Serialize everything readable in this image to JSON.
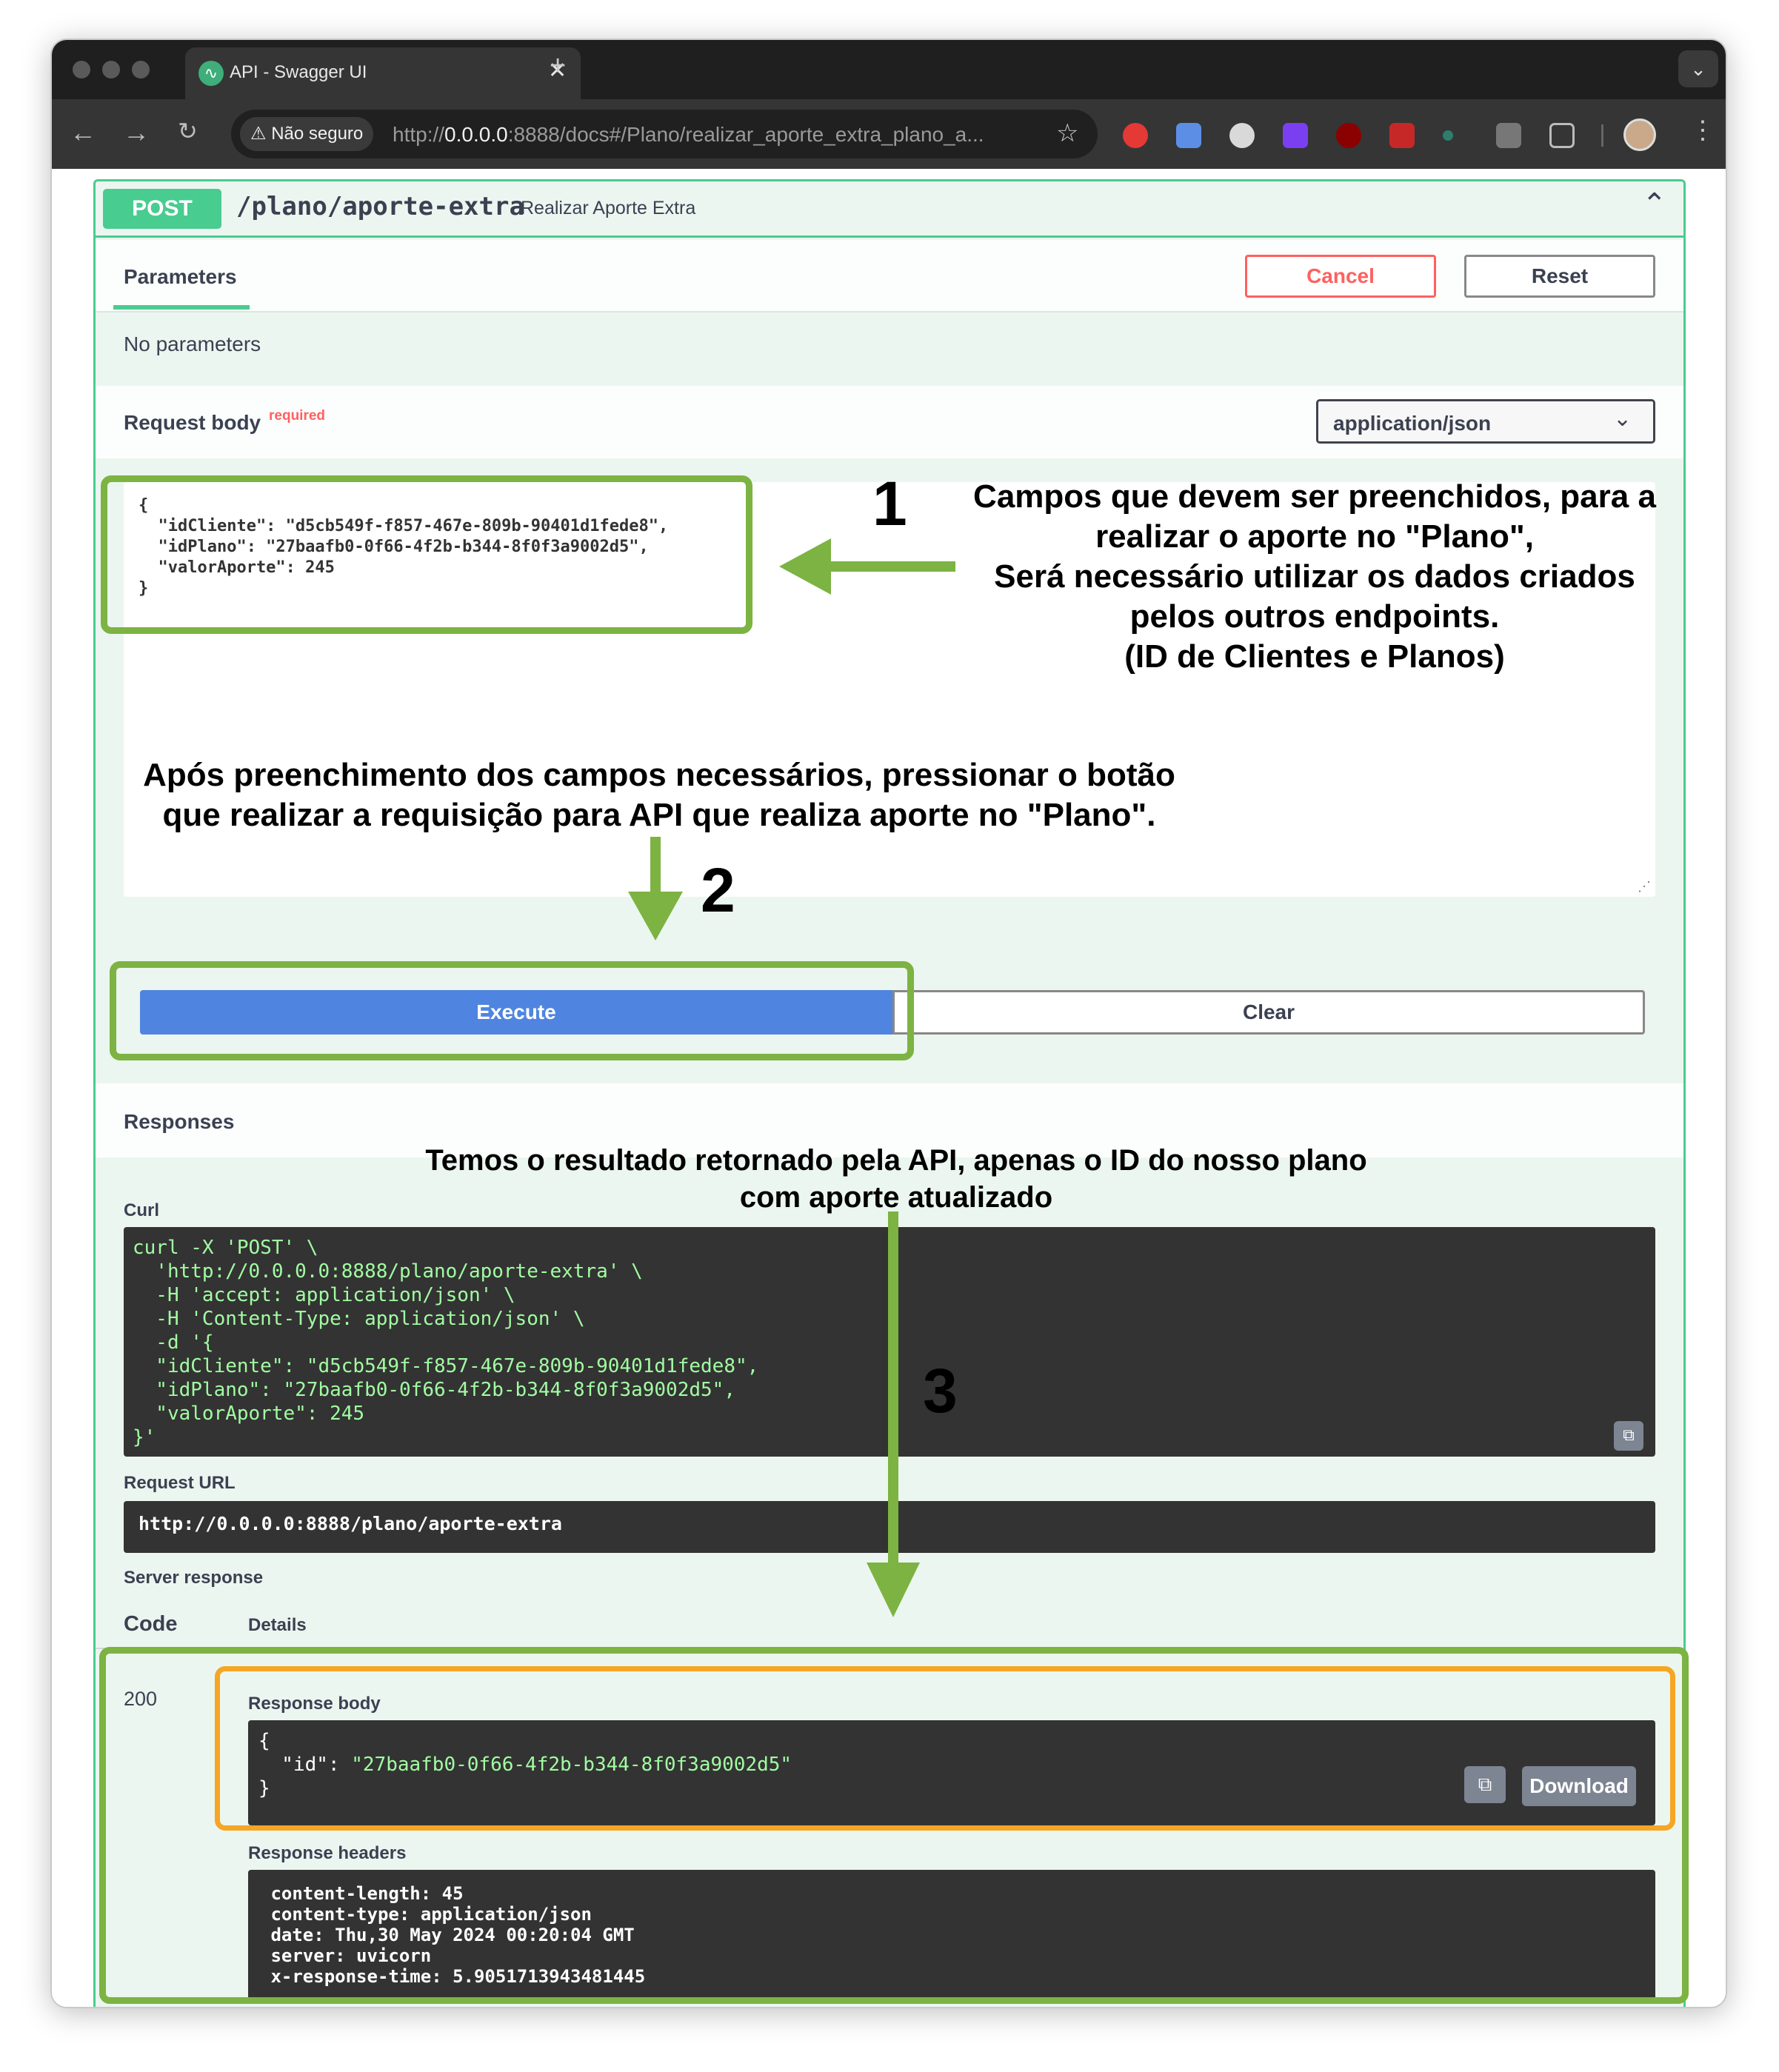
{
  "browser": {
    "tab_title": "API - Swagger UI",
    "tab_close": "✕",
    "new_tab": "+",
    "security_label": "Não seguro",
    "url_prefix": "http://",
    "url_host": "0.0.0.0",
    "url_rest": ":8888/docs#/Plano/realizar_aporte_extra_plano_a..."
  },
  "operation": {
    "method": "POST",
    "path": "/plano/aporte-extra",
    "summary": "Realizar Aporte Extra",
    "tab_parameters": "Parameters",
    "cancel_label": "Cancel",
    "reset_label": "Reset",
    "no_parameters": "No parameters",
    "request_body_label": "Request body",
    "required_label": "required",
    "content_type": "application/json",
    "request_body_json": "{\n  \"idCliente\": \"d5cb549f-f857-467e-809b-90401d1fede8\",\n  \"idPlano\": \"27baafb0-0f66-4f2b-b344-8f0f3a9002d5\",\n  \"valorAporte\": 245\n}",
    "execute_label": "Execute",
    "clear_label": "Clear"
  },
  "responses": {
    "title": "Responses",
    "curl_label": "Curl",
    "curl_code": "curl -X 'POST' \\\n  'http://0.0.0.0:8888/plano/aporte-extra' \\\n  -H 'accept: application/json' \\\n  -H 'Content-Type: application/json' \\\n  -d '{\n  \"idCliente\": \"d5cb549f-f857-467e-809b-90401d1fede8\",\n  \"idPlano\": \"27baafb0-0f66-4f2b-b344-8f0f3a9002d5\",\n  \"valorAporte\": 245\n}'",
    "request_url_label": "Request URL",
    "request_url": "http://0.0.0.0:8888/plano/aporte-extra",
    "server_response_label": "Server response",
    "code_header": "Code",
    "details_header": "Details",
    "status_code": "200",
    "response_body_label": "Response body",
    "response_body_open": "{",
    "response_body_key": "  \"id\": ",
    "response_body_value": "\"27baafb0-0f66-4f2b-b344-8f0f3a9002d5\"",
    "response_body_close": "}",
    "download_label": "Download",
    "response_headers_label": "Response headers",
    "response_headers": " content-length: 45\n content-type: application/json\n date: Thu,30 May 2024 00:20:04 GMT\n server: uvicorn\n x-response-time: 5.9051713943481445"
  },
  "annotations": {
    "n1": "1",
    "text1": "Campos que devem ser preenchidos, para a\nrealizar o aporte no \"Plano\",\nSerá necessário utilizar os dados criados\npelos outros endpoints.\n(ID de Clientes e Planos)",
    "text2": "Após preenchimento dos campos necessários, pressionar o botão\nque realizar a requisição para API que realiza aporte no \"Plano\".",
    "n2": "2",
    "text3": "Temos o resultado retornado pela API, apenas o ID do nosso plano\ncom aporte atualizado",
    "n3": "3"
  },
  "colors": {
    "post_green": "#49cc90",
    "annotation_green": "#7cb342",
    "annotation_orange": "#f5a623",
    "execute_blue": "#4f85e0",
    "cancel_red": "#ff6060"
  }
}
